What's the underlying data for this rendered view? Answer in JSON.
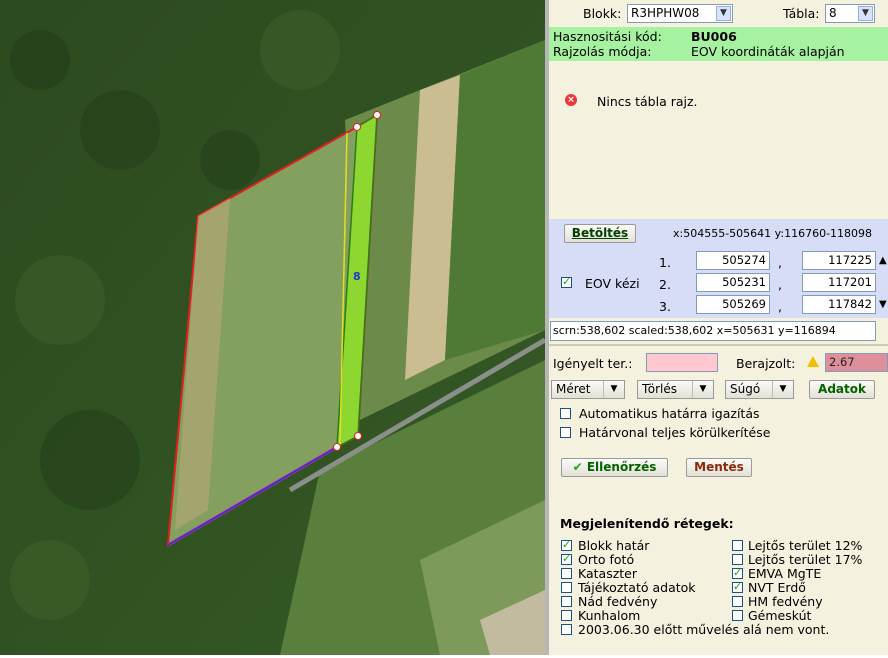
{
  "header": {
    "blokk_label": "Blokk:",
    "blokk_value": "R3HPHW08",
    "tabla_label": "Tábla:",
    "tabla_value": "8"
  },
  "info": {
    "hasznositasi_label": "Hasznositási kód:",
    "hasznositasi_value": "BU006",
    "rajzolas_label": "Rajzolás módja:",
    "rajzolas_value": "EOV koordináták alapján"
  },
  "message": "Nincs tábla rajz.",
  "eov": {
    "load_button": "Betöltés",
    "range": "x:504555-505641 y:116760-118098",
    "manual_label": "EOV kézi",
    "manual_checked": true,
    "rows": [
      {
        "n": "1.",
        "x": "505274",
        "sep": ",",
        "y": "117225"
      },
      {
        "n": "2.",
        "x": "505231",
        "sep": ",",
        "y": "117201"
      },
      {
        "n": "3.",
        "x": "505269",
        "sep": ",",
        "y": "117842"
      }
    ]
  },
  "status_line": "scrn:538,602 scaled:538,602 x=505631 y=116894",
  "area": {
    "igenyelt_label": "Igényelt ter.:",
    "igenyelt_value": "",
    "berajzolt_label": "Berajzolt:",
    "berajzolt_value": "2.67",
    "warning_icon": "warning-icon"
  },
  "toolbar": {
    "meret": "Méret",
    "torles": "Törlés",
    "sugo": "Súgó",
    "adatok": "Adatok"
  },
  "options": [
    {
      "label": "Automatikus határra igazítás",
      "checked": false
    },
    {
      "label": "Határvonal teljes körülkerítése",
      "checked": false
    }
  ],
  "actions": {
    "ellenorzes": "Ellenőrzés",
    "mentes": "Mentés"
  },
  "layers": {
    "title": "Megjelenítendő rétegek:",
    "left": [
      {
        "label": "Blokk határ",
        "checked": true
      },
      {
        "label": "Orto fotó",
        "checked": true
      },
      {
        "label": "Kataszter",
        "checked": false
      },
      {
        "label": "Tájékoztató adatok",
        "checked": false
      },
      {
        "label": "Nád fedvény",
        "checked": false
      },
      {
        "label": "Kunhalom",
        "checked": false
      }
    ],
    "right": [
      {
        "label": "Lejtős terület 12%",
        "checked": false
      },
      {
        "label": "Lejtős terület 17%",
        "checked": false
      },
      {
        "label": "EMVA MgTE",
        "checked": true
      },
      {
        "label": "NVT Erdő",
        "checked": true
      },
      {
        "label": "HM fedvény",
        "checked": false
      },
      {
        "label": "Gémeskút",
        "checked": false
      }
    ],
    "bottom": {
      "label": "2003.06.30 előtt művelés alá nem vont.",
      "checked": false
    }
  },
  "map": {
    "parcel_label": "8"
  },
  "colors": {
    "panel_bg": "#f4f1df",
    "info_green": "#a6f2a0",
    "eov_blue": "#d7dcf7",
    "block_border": "#e02020",
    "parcel_fill": "#8ed630",
    "area_pink": "#ffc8d0"
  }
}
